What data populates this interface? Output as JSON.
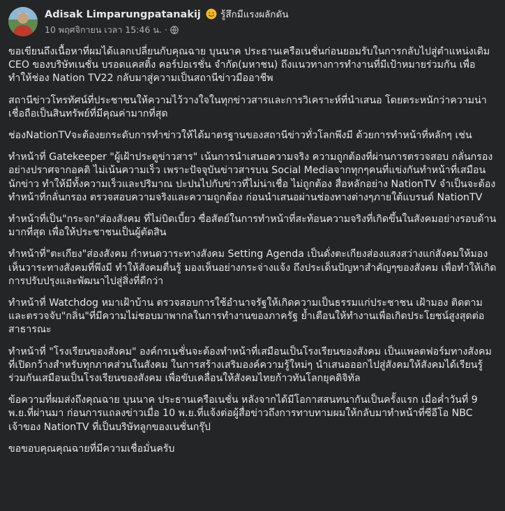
{
  "post": {
    "author_name": "Adisak Limparungpatanakij",
    "feeling_emoji": "smiling-face-icon",
    "feeling_text": "รู้สึกมีแรงผลักดัน",
    "timestamp": "10 พฤศจิกายน เวลา 15:46 น.",
    "separator": "·",
    "audience_icon": "globe-icon",
    "paragraphs": [
      "ขอเขียนถึงเนื้อหาที่ผมได้แลกเปลี่ยนกับคุณฉาย บุนนาค ประธานเครือเนชั่นก่อนยอมรับในการกลับไปสู่ตำแหน่งเดิม CEO ของบริษัทเนชั่น บรอดแคสติ้ง คอร์ปอเรชั่น จำกัด(มหาชน) ถึงแนวทางการทำงานที่มีเป้าหมายร่วมกัน เพื่อทำให้ช่อง Nation TV22 กลับมาสู่ความเป็นสถานีข่าวมืออาชีพ",
      "สถานีข่าวโทรทัศน์ที่ประชาชนให้ความไว้วางใจในทุกข่าวสารและการวิเคราะห์ที่นำเสนอ โดยตระหนักว่าความน่าเชื่อถือเป็นสินทรัพย์ที่มีคุณค่ามากที่สุด",
      "ช่องNationTVจะต้องยกระดับการทำข่าวให้ได้มาตรฐานของสถานีข่าวทั่วโลกพึงมี ด้วยการทำหน้าที่หลักๆ เช่น",
      "ทำหน้าที่ Gatekeeper \"ผู้เฝ้าประตูข่าวสาร\" เน้นการนำเสนอความจริง ความถูกต้องที่ผ่านการตรวจสอบ กลั่นกรองอย่างปราศจากอคติ ไม่เน้นความเร็ว เพราะปัจจุบันข่าวสารบน Social Mediaจากทุกๆคนที่แข่งกันทำหน้าที่เสมือนนักข่าว ทำให้มีทั้งความเร็วและปริมาณ ปะปนไปกับข่าวที่ไม่น่าเชื่อ ไม่ถูกต้อง สื่อหลักอย่าง NationTV จำเป็นจะต้องทำหน้าที่กลั่นกรอง ตรวจสอบความจริงและความถูกต้อง ก่อนนำเสนอผ่านช่องทางต่างๆภายใต้แบรนด์ NationTV",
      "ทำหน้าที่เป็น\"กระจก\"ส่องสังคม ที่ไม่บิดเบี้ยว ซื่อสัตย์ในการทำหน้าที่สะท้อนความจริงที่เกิดขึ้นในสังคมอย่างรอบด้านมากที่สุด เพื่อให้ประชาชนเป็นผู้ตัดสิน",
      "ทำหน้าที่\"ตะเกียง\"ส่องสังคม กำหนดวาระทางสังคม Setting Agenda เป็นดั่งตะเกียงส่องแสงสว่างแก่สังคมให้มองเห็นวาระทางสังคมที่พึงมี ทำให้สังคมตื่นรู้ มองเห็นอย่างกระจ่างแจ้ง ถึงประเด็นปัญหาสำคัญๆของสังคม เพื่อทำให้เกิดการปรับปรุงและพัฒนาไปสู่สิ่งที่ดีกว่า",
      "ทำหน้าที่ Watchdog หมาเฝ้าบ้าน ตรวจสอบการใช้อำนาจรัฐให้เกิดความเป็นธรรมแก่ประชาชน เฝ้ามอง ติดตามและตรวจจับ\"กลิ่น\"ที่มีความไม่ชอบมาพากลในการทำงานของภาครัฐ ย้ำเตือนให้ทำงานเพื่อเกิดประโยชน์สูงสุดต่อสาธารณะ",
      "ทำหน้าที่ \"โรงเรียนของสังคม\" องค์กรเนชั่นจะต้องทำหน้าที่เสมือนเป็นโรงเรียนของสังคม เป็นแพลตฟอร์มทางสังคมที่เปิดกว้างสำหรับทุกภาคส่วนในสังคม ในการสร้างเสริมองค์ความรู้ใหม่ๆ นำเสนอออกไปสู่สังคมให้สังคมได้เรียนรู้ร่วมกันเสมือนเป็นโรงเรียนของสังคม เพื่อขับเคลื่อนให้สังคมไทยก้าวทันโลกยุคดิจิทัล",
      "ข้อความที่ผมส่งถึงคุณฉาย บุนนาค ประธานเครือเนชั่น หลังจากได้มีโอกาสสนทนากันเป็นครั้งแรก เมื่อค่ำวันที่ 9 พ.ย.ที่ผ่านมา ก่อนการแถลงข่าวเมื่อ 10 พ.ย.ที่แจ้งต่อผู้สื่อข่าวถึงการทาบทามผมให้กลับมาทำหน้าที่ซีอีโอ NBC เจ้าของ NationTV ที่เป็นบริษัทลูกของเนชั่นกรุ๊ป",
      "ขอขอบคุณคุณฉายที่มีความเชื่อมั่นครับ"
    ]
  },
  "colors": {
    "background": "#242526",
    "primary_text": "#e4e6eb",
    "secondary_text": "#b0b3b8"
  }
}
